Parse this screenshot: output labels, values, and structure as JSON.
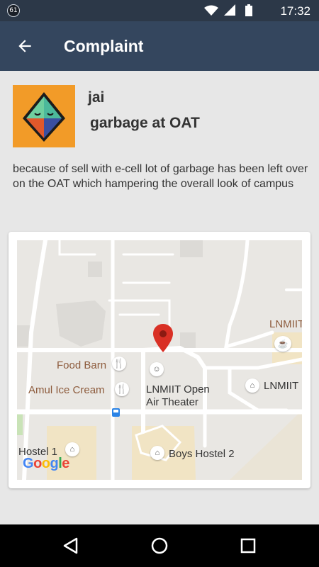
{
  "status_bar": {
    "notification_count": "61",
    "time": "17:32"
  },
  "app_bar": {
    "title": "Complaint"
  },
  "complaint": {
    "user": "jai",
    "subject": "garbage at OAT",
    "description": "because of sell with e-cell lot of garbage has been left over on the OAT which hampering the overall look of campus"
  },
  "map": {
    "labels": {
      "food_barn": "Food Barn",
      "amul": "Amul Ice Cream",
      "oat_line1": "LNMIIT Open",
      "oat_line2": "Air Theater",
      "lnmiit_right": "LNMIIT",
      "lnmiit_top": "LNMIIT",
      "hostel1": "Hostel 1",
      "boys_hostel2": "Boys Hostel 2",
      "google": "Google"
    },
    "colors": {
      "label_brown": "#8d5b3c",
      "pin_red": "#d93025"
    }
  },
  "nav": {
    "back": "back-nav-icon",
    "home": "home-nav-icon",
    "recents": "recents-nav-icon"
  }
}
